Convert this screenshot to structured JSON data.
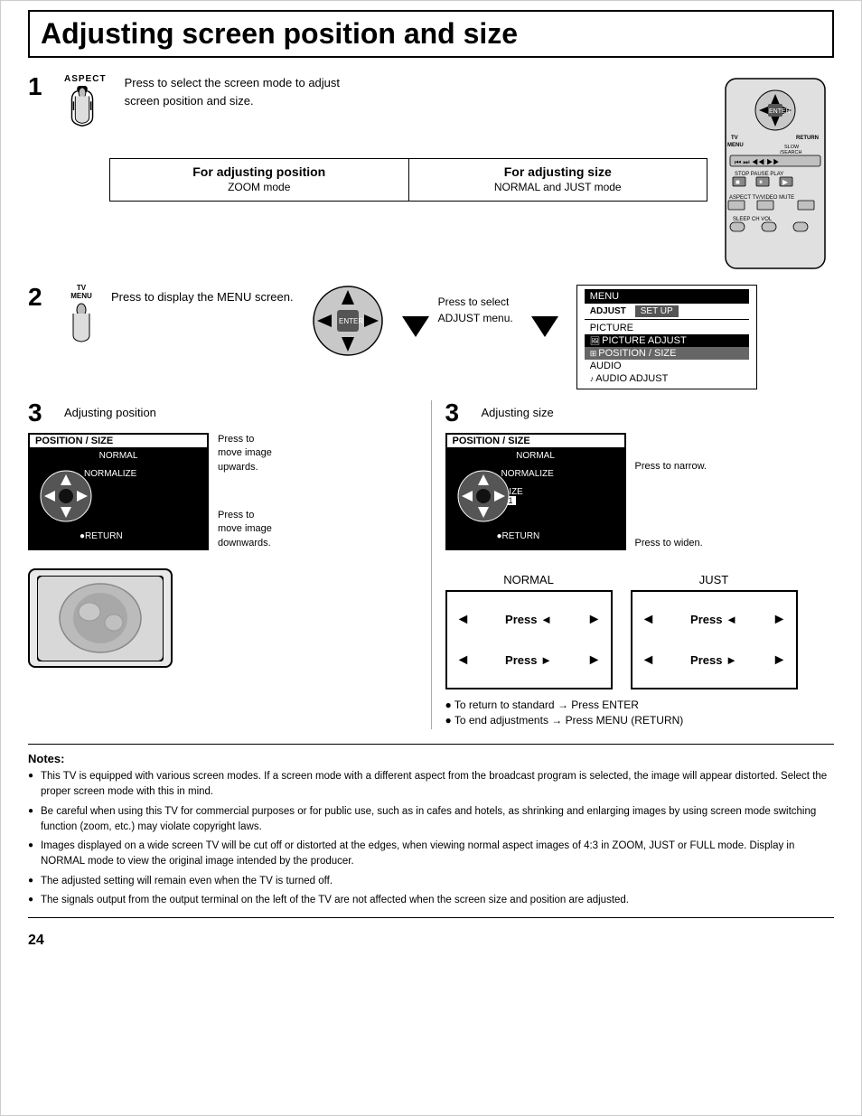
{
  "title": "Adjusting screen position and size",
  "step1": {
    "aspect_label": "ASPECT",
    "desc_line1": "Press to select the screen mode to adjust",
    "desc_line2": "screen position and size.",
    "for_position": "For adjusting position",
    "zoom_mode": "ZOOM mode",
    "for_size": "For adjusting size",
    "normal_just": "NORMAL and JUST mode"
  },
  "step2": {
    "tv_menu_label": "TV\nMENU",
    "desc": "Press to display the MENU screen.",
    "press_select": "Press to select\nADJUST menu.",
    "menu": {
      "title": "MENU",
      "tab1": "ADJUST",
      "tab2": "SET UP",
      "item1": "PICTURE",
      "item2": "PICTURE ADJUST",
      "item3": "POSITION / SIZE",
      "item4": "AUDIO",
      "item5": "AUDIO ADJUST"
    }
  },
  "step3_left": {
    "label": "Adjusting position",
    "pos_size_title": "POSITION / SIZE",
    "normal_label": "NORMAL",
    "normalize_label": "NORMALIZE",
    "return_label": "●RETURN",
    "press_up": "Press to\nmove image\nupwards.",
    "press_down": "Press to\nmove image\ndownwards."
  },
  "step3_right": {
    "label": "Adjusting size",
    "pos_size_title": "POSITION / SIZE",
    "normal_label": "NORMAL",
    "normalize_label": "NORMALIZE",
    "size_label": "SIZE",
    "size_val": "1",
    "return_label": "●RETURN",
    "press_narrow": "Press to narrow.",
    "press_widen": "Press to widen."
  },
  "press_boxes": {
    "normal_label": "NORMAL",
    "just_label": "JUST",
    "normal_press_left": "Press ◄",
    "normal_press_right": "Press ►",
    "just_press_left": "Press ◄",
    "just_press_right": "Press ►"
  },
  "bullets": {
    "return_standard": "To return to standard  →  Press ENTER",
    "end_adjustments": "To end adjustments   →  Press MENU (RETURN)"
  },
  "notes": {
    "title": "Notes:",
    "items": [
      "This TV is equipped with various screen modes. If a screen mode with a different aspect from the broadcast program is selected, the image will appear distorted. Select the proper screen mode with this in mind.",
      "Be careful when using this TV for commercial purposes or for public use, such as in cafes and hotels, as shrinking and enlarging images by using screen mode switching function (zoom, etc.) may violate copyright laws.",
      "Images displayed on a wide screen TV will be cut off or distorted at the edges, when viewing normal aspect images of 4:3 in ZOOM, JUST or FULL mode. Display in NORMAL mode to view the original image intended by the producer.",
      "The adjusted setting will remain even when the TV is turned off.",
      "The signals output from the output terminal on the left of the TV are not affected when the screen size and position are adjusted."
    ]
  },
  "page_num": "24"
}
